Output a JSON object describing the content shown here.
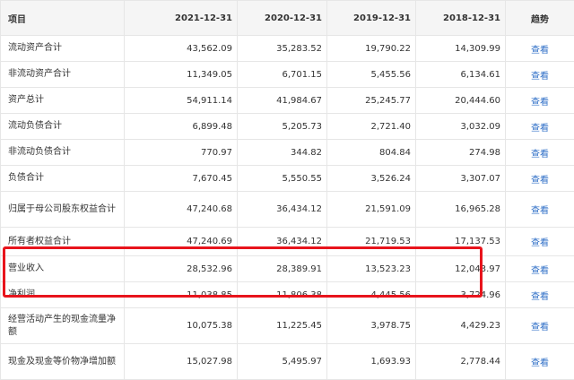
{
  "header": {
    "item": "项目",
    "periods": [
      "2021-12-31",
      "2020-12-31",
      "2019-12-31",
      "2018-12-31"
    ],
    "trend": "趋势"
  },
  "rows": [
    {
      "label": "流动资产合计",
      "values": [
        "43,562.09",
        "35,283.52",
        "19,790.22",
        "14,309.99"
      ],
      "link": "查看"
    },
    {
      "label": "非流动资产合计",
      "values": [
        "11,349.05",
        "6,701.15",
        "5,455.56",
        "6,134.61"
      ],
      "link": "查看"
    },
    {
      "label": "资产总计",
      "values": [
        "54,911.14",
        "41,984.67",
        "25,245.77",
        "20,444.60"
      ],
      "link": "查看"
    },
    {
      "label": "流动负债合计",
      "values": [
        "6,899.48",
        "5,205.73",
        "2,721.40",
        "3,032.09"
      ],
      "link": "查看"
    },
    {
      "label": "非流动负债合计",
      "values": [
        "770.97",
        "344.82",
        "804.84",
        "274.98"
      ],
      "link": "查看"
    },
    {
      "label": "负债合计",
      "values": [
        "7,670.45",
        "5,550.55",
        "3,526.24",
        "3,307.07"
      ],
      "link": "查看"
    },
    {
      "label": "归属于母公司股东权益合计",
      "values": [
        "47,240.68",
        "36,434.12",
        "21,591.09",
        "16,965.28"
      ],
      "link": "查看"
    },
    {
      "label": "所有者权益合计",
      "values": [
        "47,240.69",
        "36,434.12",
        "21,719.53",
        "17,137.53"
      ],
      "link": "查看"
    },
    {
      "label": "营业收入",
      "values": [
        "28,532.96",
        "28,389.91",
        "13,523.23",
        "12,043.97"
      ],
      "link": "查看"
    },
    {
      "label": "净利润",
      "values": [
        "11,038.85",
        "11,806.38",
        "4,445.56",
        "3,724.96"
      ],
      "link": "查看"
    },
    {
      "label": "经营活动产生的现金流量净额",
      "values": [
        "10,075.38",
        "11,225.45",
        "3,978.75",
        "4,429.23"
      ],
      "link": "查看"
    },
    {
      "label": "现金及现金等价物净增加额",
      "values": [
        "15,027.98",
        "5,495.97",
        "1,693.93",
        "2,778.44"
      ],
      "link": "查看"
    }
  ],
  "highlight": {
    "rows": [
      "营业收入",
      "净利润"
    ],
    "color": "#e8141c"
  },
  "colors": {
    "header_bg": "#f5f5f5",
    "border": "#e6e6e6",
    "link": "#2f6fc7"
  }
}
